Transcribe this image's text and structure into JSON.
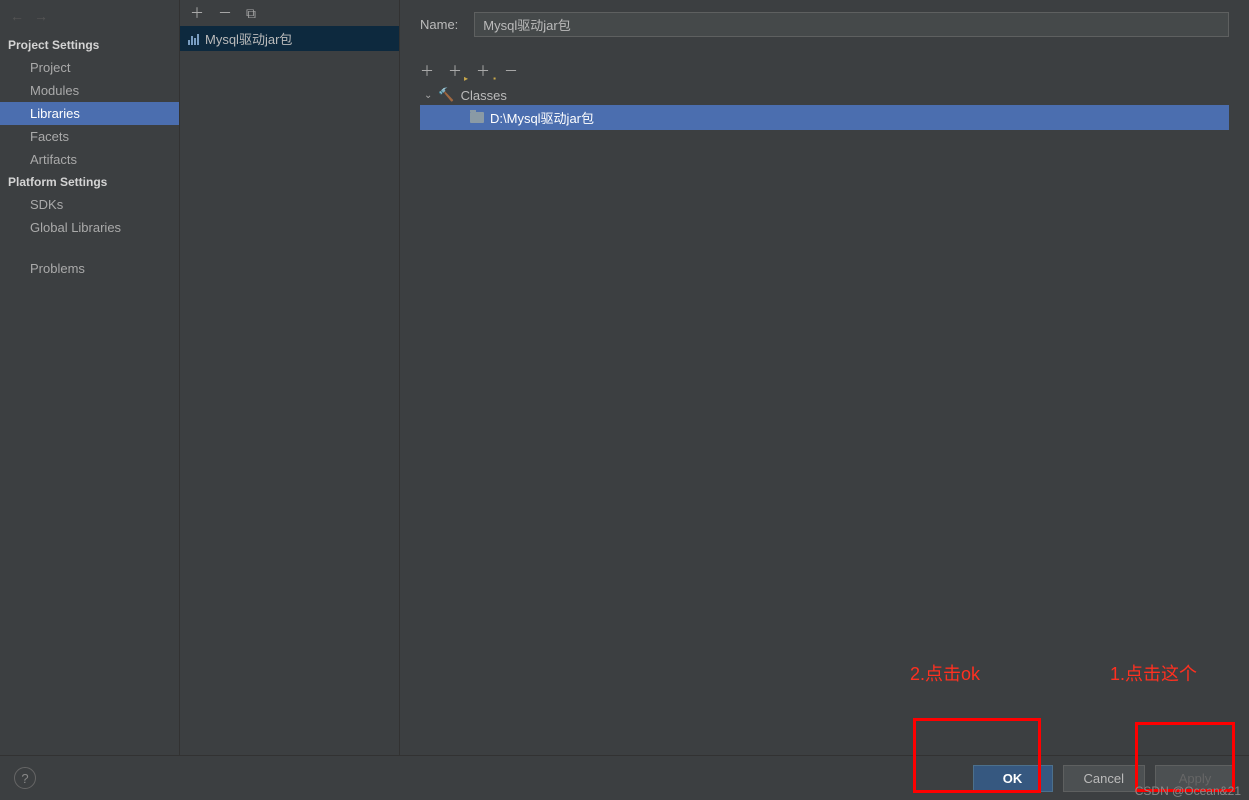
{
  "sidebar": {
    "section1_header": "Project Settings",
    "section1_items": [
      "Project",
      "Modules",
      "Libraries",
      "Facets",
      "Artifacts"
    ],
    "section2_header": "Platform Settings",
    "section2_items": [
      "SDKs",
      "Global Libraries"
    ],
    "problems_label": "Problems"
  },
  "library_list": {
    "item_name": "Mysql驱动jar包"
  },
  "detail": {
    "name_label": "Name:",
    "name_value": "Mysql驱动jar包",
    "classes_label": "Classes",
    "class_path": "D:\\Mysql驱动jar包"
  },
  "buttons": {
    "ok": "OK",
    "cancel": "Cancel",
    "apply": "Apply"
  },
  "annotations": {
    "first": "1.点击这个",
    "second": "2.点击ok"
  },
  "watermark": "CSDN @Ocean&21"
}
